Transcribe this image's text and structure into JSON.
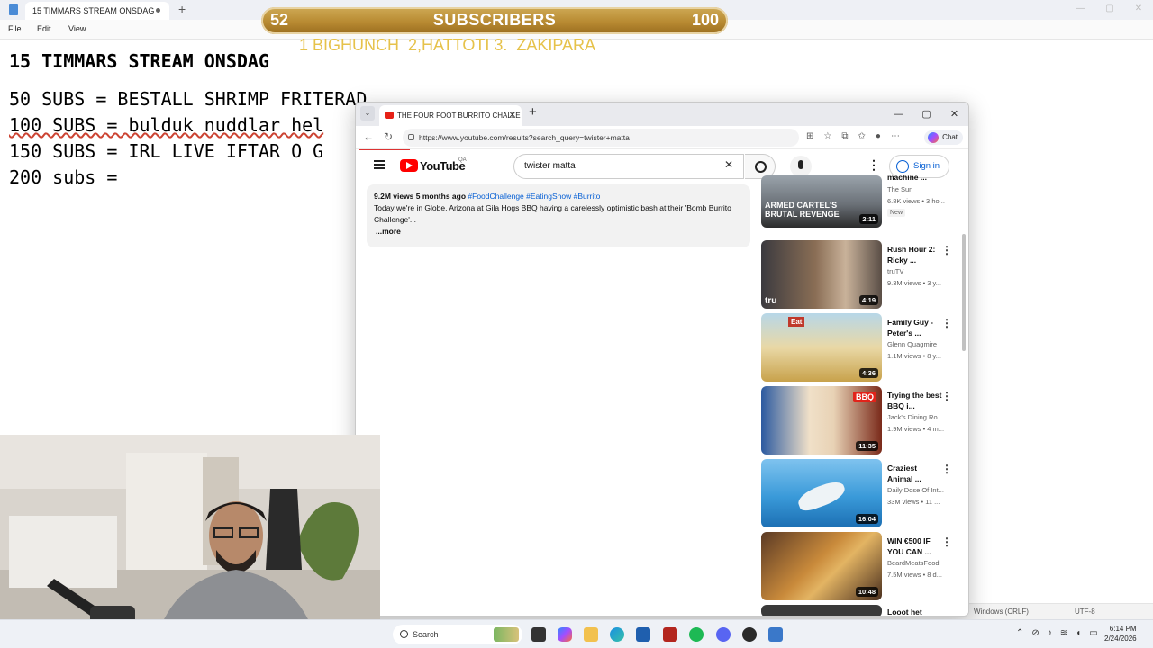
{
  "notepad": {
    "tab_title": "15 TIMMARS STREAM ONSDAG",
    "menus": [
      "File",
      "Edit",
      "View"
    ],
    "lines": [
      "15 TIMMARS STREAM ONSDAG",
      "50 SUBS = BESTALL SHRIMP FRITERAD",
      "100 SUBS = bulduk nuddlar hel",
      "150 SUBS = IRL LIVE IFTAR O G",
      "200 subs ="
    ],
    "status": {
      "line_ending": "Windows (CRLF)",
      "encoding": "UTF-8"
    }
  },
  "overlay": {
    "current": "52",
    "label": "SUBSCRIBERS",
    "goal": "100",
    "progress": 0.52,
    "subline": "1 BIGHUNCH  2,HATTOTI 3.  ZAKIPARA"
  },
  "browser": {
    "tab_title": "THE FOUR FOOT BURRITO CHALLE",
    "url": "https://www.youtube.com/results?search_query=twister+matta",
    "chat_label": "Chat"
  },
  "youtube": {
    "logo_text": "YouTube",
    "country_code": "QA",
    "search_value": "twister matta",
    "signin_label": "Sign in",
    "video": {
      "meta": "9.2M views  5 months ago",
      "tags": "#FoodChallenge #EatingShow #Burrito",
      "description": "Today we're in Globe, Arizona at Gila Hogs BBQ having a carelessly optimistic bash at their 'Bomb Burrito Challenge'...",
      "more": "...more"
    },
    "recommendations": [
      {
        "title": "machine ...",
        "channel": "The Sun",
        "meta": "6.8K views • 3 ho...",
        "badge": "New",
        "duration": "2:11",
        "thumb_text": "ARMED CARTEL'S BRUTAL REVENGE"
      },
      {
        "title": "Rush Hour 2: Ricky ...",
        "channel": "truTV",
        "meta": "9.3M views • 3 y...",
        "badge": "",
        "duration": "4:19",
        "thumb_text": "tru"
      },
      {
        "title": "Family Guy - Peter's ...",
        "channel": "Glenn Quagmire",
        "meta": "1.1M views • 8 y...",
        "badge": "",
        "duration": "4:36",
        "thumb_text": "Eat"
      },
      {
        "title": "Trying the best BBQ i...",
        "channel": "Jack's Dining Ro...",
        "meta": "1.9M views • 4 m...",
        "badge": "",
        "duration": "11:35",
        "thumb_text": "BBQ"
      },
      {
        "title": "Craziest Animal ...",
        "channel": "Daily Dose Of Int...",
        "meta": "33M views • 11 ...",
        "badge": "",
        "duration": "16:04",
        "thumb_text": ""
      },
      {
        "title": "WIN €500 IF YOU CAN ...",
        "channel": "BeardMeatsFood",
        "meta": "7.5M views • 8 d...",
        "badge": "",
        "duration": "10:48",
        "thumb_text": ""
      },
      {
        "title": "Looot het",
        "channel": "",
        "meta": "",
        "badge": "",
        "duration": "",
        "thumb_text": ""
      }
    ]
  },
  "taskbar": {
    "search_placeholder": "Search",
    "time": "6:14 PM",
    "date": "2/24/2026"
  },
  "colors": {
    "overlay_gold": "#b88a32",
    "overlay_text": "#e6c24a",
    "youtube_red": "#ff0000",
    "link_blue": "#065fd4"
  }
}
